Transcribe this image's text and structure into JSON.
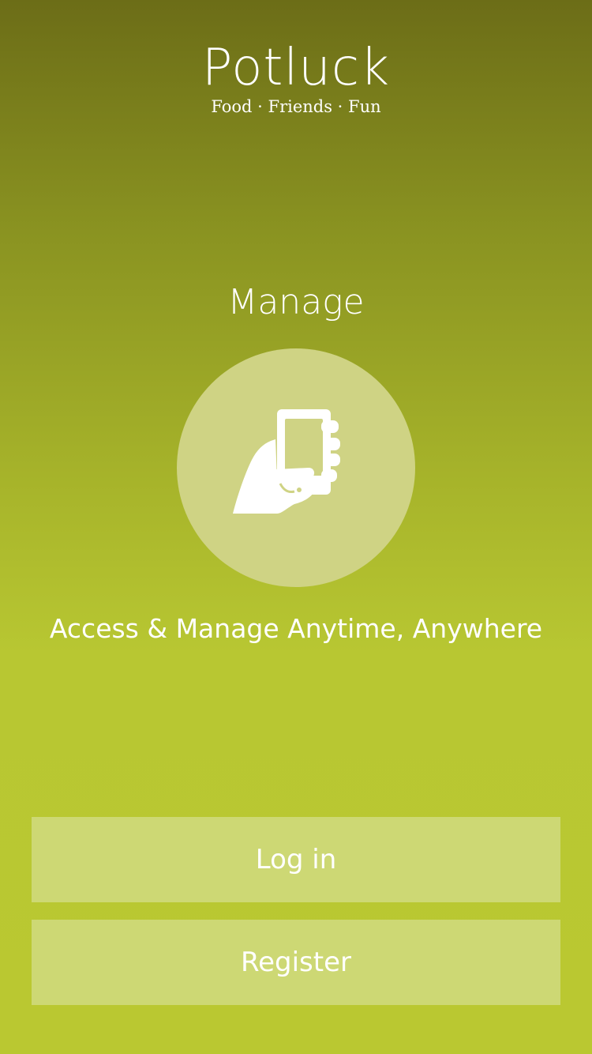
{
  "app": {
    "title": "Potluck",
    "tagline": "Food · Friends · Fun"
  },
  "feature": {
    "title": "Manage",
    "icon": "hand-holding-phone-icon",
    "description": "Access & Manage Anytime, Anywhere"
  },
  "actions": {
    "login_label": "Log in",
    "register_label": "Register"
  },
  "colors": {
    "gradient_top": "#6c6d17",
    "gradient_bottom": "#bac831",
    "circle": "#cfd384",
    "button": "#cdd874",
    "text": "#ffffff"
  }
}
